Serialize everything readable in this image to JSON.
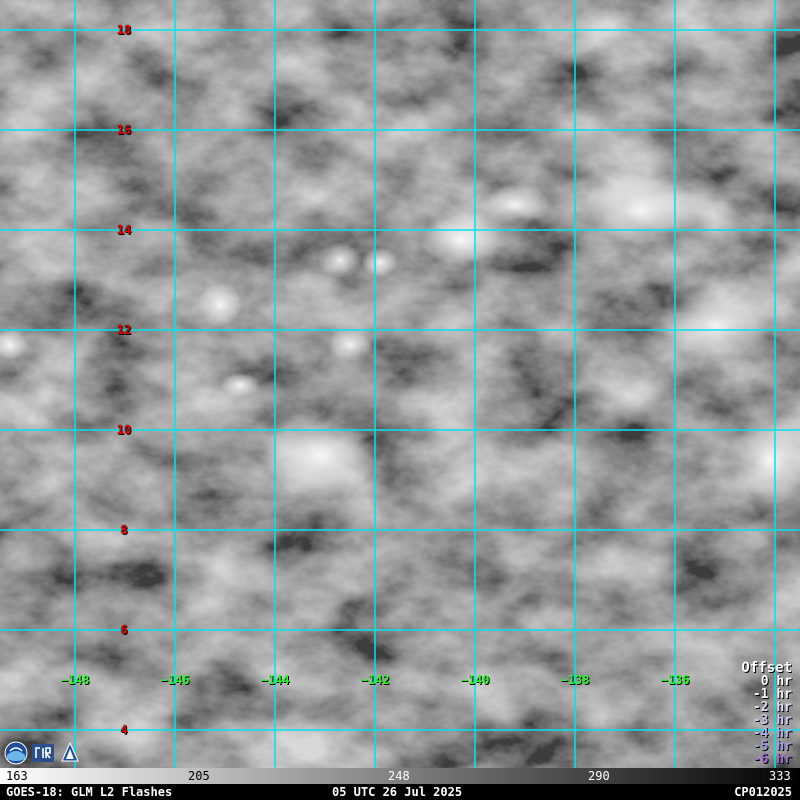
{
  "map": {
    "latitudes": [
      "18",
      "16",
      "14",
      "12",
      "10",
      "8",
      "6",
      "4"
    ],
    "longitudes": [
      "−148",
      "−146",
      "−144",
      "−142",
      "−140",
      "−138",
      "−136"
    ],
    "lat_label_color": "#e00000",
    "lon_label_color": "#22ff22",
    "grid_color": "#00e5ee"
  },
  "legend": {
    "title": "Offset",
    "items": [
      {
        "label": "0 hr",
        "color": "#ffffff"
      },
      {
        "label": "-1 hr",
        "color": "#f0f0f0"
      },
      {
        "label": "-2 hr",
        "color": "#dcdcf0"
      },
      {
        "label": "-3 hr",
        "color": "#c8c8ec"
      },
      {
        "label": "-4 hr",
        "color": "#aab4e6"
      },
      {
        "label": "-5 hr",
        "color": "#9c9ce0"
      },
      {
        "label": "-6 hr",
        "color": "#9a70c8"
      }
    ]
  },
  "colorbar": {
    "ticks": [
      "163",
      "205",
      "248",
      "290",
      "333"
    ]
  },
  "footer": {
    "left": "GOES-18: GLM L2 Flashes",
    "center": "05 UTC 26 Jul 2025",
    "right": "CP012025"
  },
  "logos": [
    "noaa-logo-icon",
    "cira-logo-icon",
    "csu-logo-icon"
  ]
}
